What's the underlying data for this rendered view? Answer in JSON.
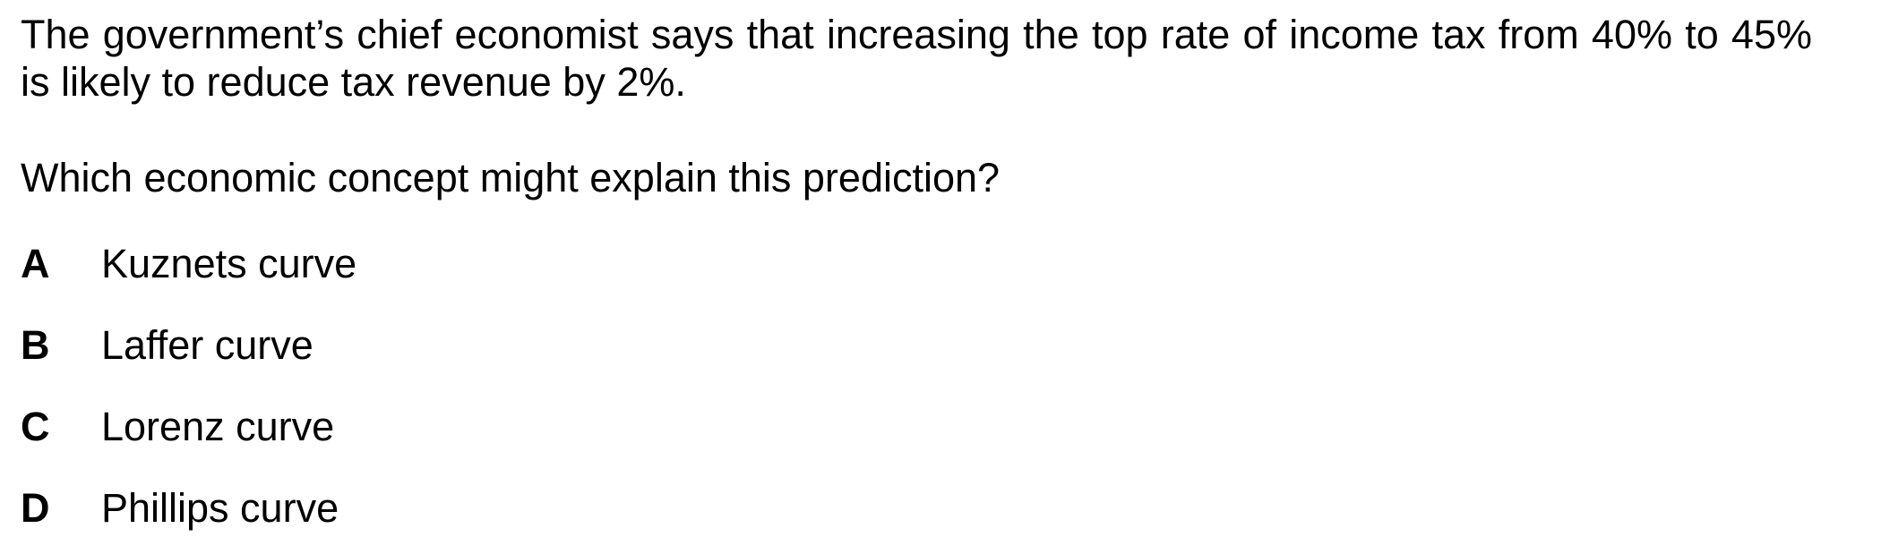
{
  "question": {
    "stem": "The government’s chief economist says that increasing the top rate of income tax from 40% to 45% is likely to reduce tax revenue by 2%.",
    "prompt": "Which economic concept might explain this prediction?",
    "options": [
      {
        "letter": "A",
        "text": "Kuznets curve"
      },
      {
        "letter": "B",
        "text": "Laffer curve"
      },
      {
        "letter": "C",
        "text": "Lorenz curve"
      },
      {
        "letter": "D",
        "text": "Phillips curve"
      }
    ]
  }
}
